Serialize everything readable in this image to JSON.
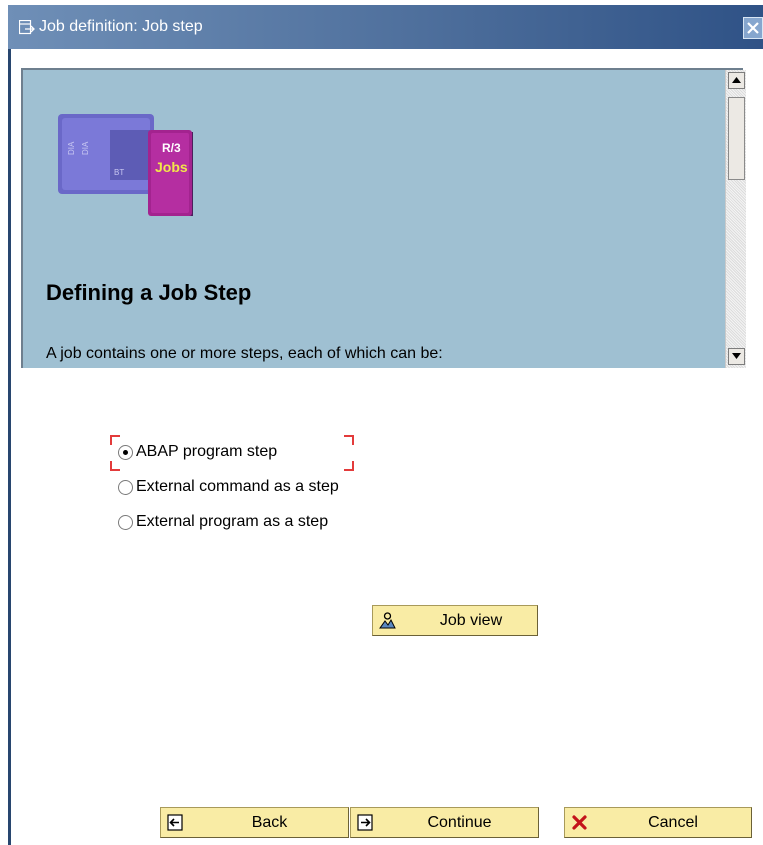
{
  "window": {
    "title": "Job definition: Job step"
  },
  "help": {
    "logo_text_top": "R/3",
    "logo_text_bottom": "Jobs",
    "heading": "Defining a Job Step",
    "intro": "A job contains one or more steps, each of which can be:"
  },
  "step_options": [
    {
      "label": "ABAP program step",
      "selected": true
    },
    {
      "label": "External command as a step",
      "selected": false
    },
    {
      "label": "External program as a step",
      "selected": false
    }
  ],
  "buttons": {
    "job_view": "Job view",
    "back": "Back",
    "continue": "Continue",
    "cancel": "Cancel"
  },
  "colors": {
    "titlebar": "#4e6f9c",
    "help_panel_bg": "#9fc0d2",
    "button_bg": "#f9eca5",
    "focus_marker": "#e33b3b"
  },
  "icons": {
    "title": "window-icon",
    "close": "close-icon",
    "job_view": "job-view-icon",
    "back": "back-icon",
    "continue": "continue-icon",
    "cancel": "cancel-x-icon"
  }
}
